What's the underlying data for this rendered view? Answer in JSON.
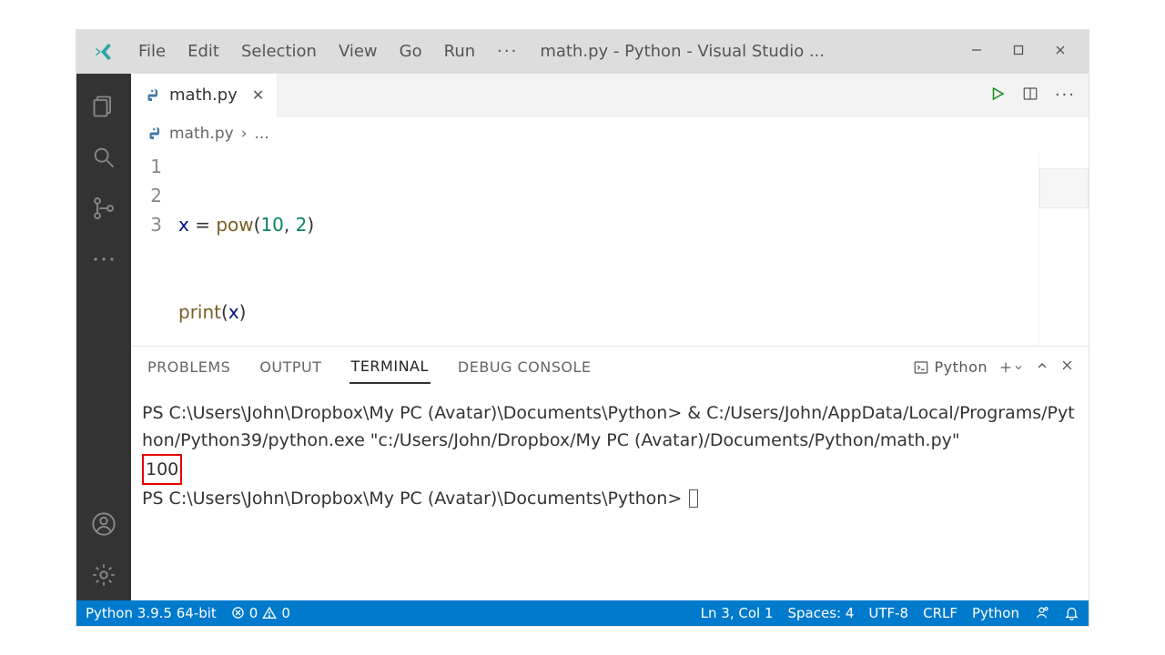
{
  "window": {
    "title": "math.py - Python - Visual Studio ..."
  },
  "menu": {
    "file": "File",
    "edit": "Edit",
    "selection": "Selection",
    "view": "View",
    "go": "Go",
    "run": "Run",
    "more": "···"
  },
  "tabs": {
    "active": {
      "label": "math.py"
    }
  },
  "breadcrumb": {
    "file": "math.py",
    "sep": "›",
    "rest": "..."
  },
  "editor": {
    "lines": {
      "l1": {
        "num": "1",
        "var": "x",
        "assign": " = ",
        "func": "pow",
        "open": "(",
        "arg1": "10",
        "comma": ", ",
        "arg2": "2",
        "close": ")"
      },
      "l2": {
        "num": "2",
        "func": "print",
        "open": "(",
        "arg": "x",
        "close": ")"
      },
      "l3": {
        "num": "3"
      }
    }
  },
  "panel": {
    "tabs": {
      "problems": "PROBLEMS",
      "output": "OUTPUT",
      "terminal": "TERMINAL",
      "debug": "DEBUG CONSOLE"
    },
    "shell_label": "Python"
  },
  "terminal": {
    "line1": "PS C:\\Users\\John\\Dropbox\\My PC (Avatar)\\Documents\\Python> & C:/Users/John/AppData/Local/Programs/Python/Python39/python.exe \"c:/Users/John/Dropbox/My PC (Avatar)/Documents/Python/math.py\"",
    "output": "100",
    "line3": "PS C:\\Users\\John\\Dropbox\\My PC (Avatar)\\Documents\\Python> "
  },
  "status": {
    "interpreter": "Python 3.9.5 64-bit",
    "errors": "0",
    "warnings": "0",
    "lncol": "Ln 3, Col 1",
    "spaces": "Spaces: 4",
    "encoding": "UTF-8",
    "eol": "CRLF",
    "language": "Python"
  }
}
